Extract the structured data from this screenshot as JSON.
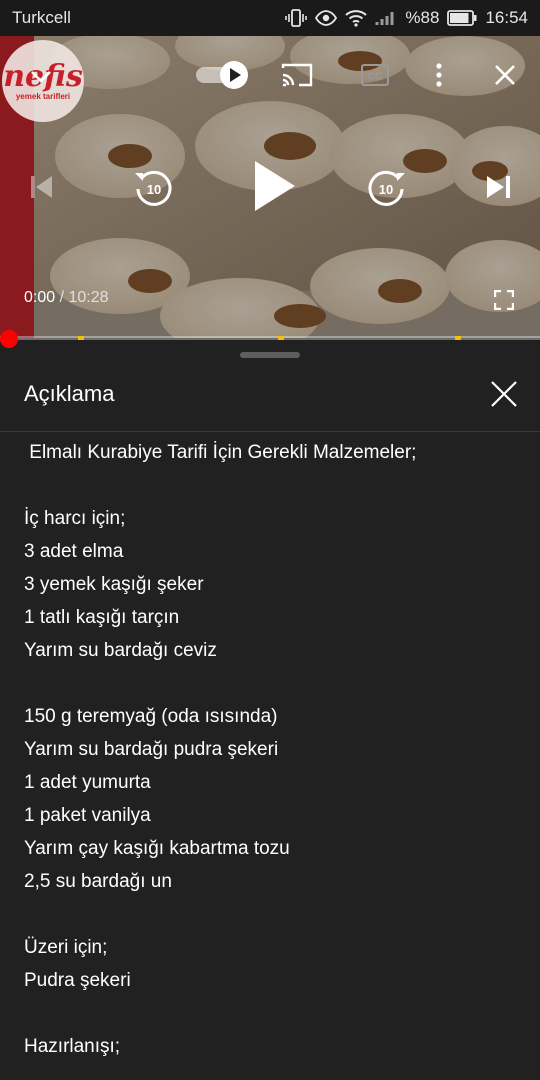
{
  "status_bar": {
    "carrier": "Turkcell",
    "battery_text": "%88",
    "clock": "16:54",
    "battery_level": 0.88
  },
  "video": {
    "channel_logo": {
      "main": "nefis",
      "sub": "yemek tarifleri"
    },
    "current_time": "0:00",
    "separator": " / ",
    "duration": "10:28",
    "progress": 0.0,
    "autoplay_on": true,
    "rewind_seconds": "10",
    "forward_seconds": "10",
    "icons": {
      "collapse": "chevron-down-icon",
      "autoplay": "autoplay-toggle-icon",
      "cast": "cast-icon",
      "captions": "captions-icon",
      "more": "more-vert-icon",
      "close": "close-icon",
      "previous": "skip-previous-icon",
      "replay": "replay-10-icon",
      "play": "play-icon",
      "forward": "forward-10-icon",
      "next": "skip-next-icon",
      "fullscreen": "fullscreen-icon"
    }
  },
  "panel": {
    "title": "Açıklama",
    "description_lines": [
      " Elmalı Kurabiye Tarifi İçin Gerekli Malzemeler;",
      "",
      "İç harcı için;",
      "3 adet elma",
      "3 yemek kaşığı şeker",
      "1 tatlı kaşığı tarçın",
      "Yarım su bardağı ceviz",
      "",
      "150 g teremyağ (oda ısısında)",
      "Yarım su bardağı pudra şekeri",
      "1 adet yumurta",
      "1 paket vanilya",
      "Yarım çay kaşığı kabartma tozu",
      "2,5 su bardağı un",
      "",
      "Üzeri için;",
      "Pudra şekeri",
      "",
      "Hazırlanışı;"
    ]
  },
  "colors": {
    "accent_red": "#ff0000",
    "chapter_marker": "#f2c200",
    "panel_bg": "#212121"
  }
}
